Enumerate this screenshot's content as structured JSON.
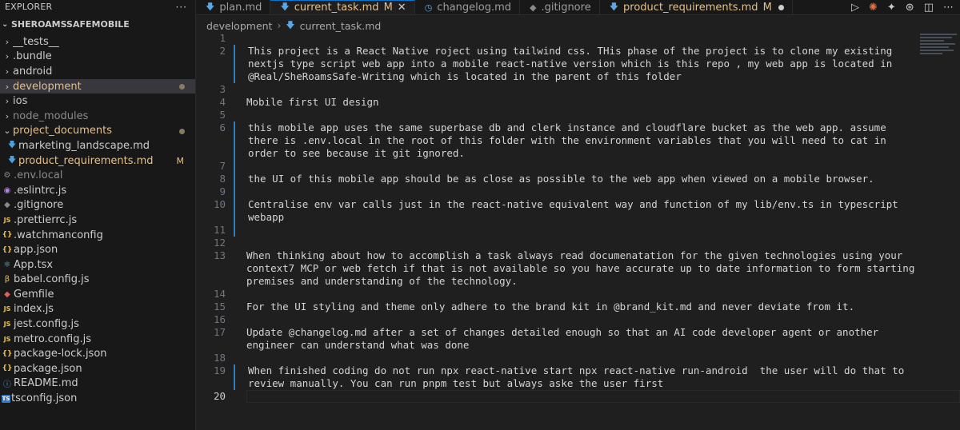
{
  "explorer": {
    "title": "EXPLORER",
    "more": "···",
    "project": "SHEROAMSSAFEMOBILE",
    "items": [
      {
        "label": "__tests__",
        "type": "folder",
        "chev": "›",
        "icon": "",
        "iconClass": "",
        "labelClass": "",
        "selected": false,
        "dot": false,
        "badge": ""
      },
      {
        "label": ".bundle",
        "type": "folder",
        "chev": "›",
        "icon": "",
        "iconClass": "",
        "labelClass": "",
        "selected": false,
        "dot": false,
        "badge": ""
      },
      {
        "label": "android",
        "type": "folder",
        "chev": "›",
        "icon": "",
        "iconClass": "",
        "labelClass": "",
        "selected": false,
        "dot": false,
        "badge": ""
      },
      {
        "label": "development",
        "type": "folder",
        "chev": "›",
        "icon": "",
        "iconClass": "",
        "labelClass": "orange",
        "selected": true,
        "dot": true,
        "badge": ""
      },
      {
        "label": "ios",
        "type": "folder",
        "chev": "›",
        "icon": "",
        "iconClass": "",
        "labelClass": "",
        "selected": false,
        "dot": false,
        "badge": ""
      },
      {
        "label": "node_modules",
        "type": "folder",
        "chev": "›",
        "icon": "",
        "iconClass": "",
        "labelClass": "dim",
        "selected": false,
        "dot": false,
        "badge": ""
      },
      {
        "label": "project_documents",
        "type": "folder",
        "chev": "⌄",
        "icon": "",
        "iconClass": "",
        "labelClass": "orange",
        "selected": false,
        "dot": true,
        "badge": ""
      },
      {
        "label": "marketing_landscape.md",
        "type": "file",
        "chev": "",
        "icon": "🡇",
        "iconClass": "i-blue",
        "labelClass": "",
        "selected": false,
        "dot": false,
        "badge": "",
        "indent": true
      },
      {
        "label": "product_requirements.md",
        "type": "file",
        "chev": "",
        "icon": "🡇",
        "iconClass": "i-blue",
        "labelClass": "orange",
        "selected": false,
        "dot": false,
        "badge": "M",
        "indent": true
      },
      {
        "label": ".env.local",
        "type": "file",
        "chev": "",
        "icon": "⚙",
        "iconClass": "i-gray",
        "labelClass": "dim",
        "selected": false,
        "dot": false,
        "badge": ""
      },
      {
        "label": ".eslintrc.js",
        "type": "file",
        "chev": "",
        "icon": "◉",
        "iconClass": "i-purple",
        "labelClass": "",
        "selected": false,
        "dot": false,
        "badge": ""
      },
      {
        "label": ".gitignore",
        "type": "file",
        "chev": "",
        "icon": "◆",
        "iconClass": "i-gray",
        "labelClass": "",
        "selected": false,
        "dot": false,
        "badge": ""
      },
      {
        "label": ".prettierrc.js",
        "type": "file",
        "chev": "",
        "icon": "JS",
        "iconClass": "i-js",
        "labelClass": "",
        "selected": false,
        "dot": false,
        "badge": ""
      },
      {
        "label": ".watchmanconfig",
        "type": "file",
        "chev": "",
        "icon": "{}",
        "iconClass": "i-json",
        "labelClass": "",
        "selected": false,
        "dot": false,
        "badge": ""
      },
      {
        "label": "app.json",
        "type": "file",
        "chev": "",
        "icon": "{}",
        "iconClass": "i-json",
        "labelClass": "",
        "selected": false,
        "dot": false,
        "badge": ""
      },
      {
        "label": "App.tsx",
        "type": "file",
        "chev": "",
        "icon": "⚛",
        "iconClass": "i-teal",
        "labelClass": "",
        "selected": false,
        "dot": false,
        "badge": ""
      },
      {
        "label": "babel.config.js",
        "type": "file",
        "chev": "",
        "icon": "β",
        "iconClass": "i-yellow",
        "labelClass": "",
        "selected": false,
        "dot": false,
        "badge": ""
      },
      {
        "label": "Gemfile",
        "type": "file",
        "chev": "",
        "icon": "◆",
        "iconClass": "i-red",
        "labelClass": "",
        "selected": false,
        "dot": false,
        "badge": ""
      },
      {
        "label": "index.js",
        "type": "file",
        "chev": "",
        "icon": "JS",
        "iconClass": "i-js",
        "labelClass": "",
        "selected": false,
        "dot": false,
        "badge": ""
      },
      {
        "label": "jest.config.js",
        "type": "file",
        "chev": "",
        "icon": "JS",
        "iconClass": "i-js",
        "labelClass": "",
        "selected": false,
        "dot": false,
        "badge": ""
      },
      {
        "label": "metro.config.js",
        "type": "file",
        "chev": "",
        "icon": "JS",
        "iconClass": "i-js",
        "labelClass": "",
        "selected": false,
        "dot": false,
        "badge": ""
      },
      {
        "label": "package-lock.json",
        "type": "file",
        "chev": "",
        "icon": "{}",
        "iconClass": "i-json",
        "labelClass": "",
        "selected": false,
        "dot": false,
        "badge": ""
      },
      {
        "label": "package.json",
        "type": "file",
        "chev": "",
        "icon": "{}",
        "iconClass": "i-json",
        "labelClass": "",
        "selected": false,
        "dot": false,
        "badge": ""
      },
      {
        "label": "README.md",
        "type": "file",
        "chev": "",
        "icon": "ⓘ",
        "iconClass": "i-blue",
        "labelClass": "",
        "selected": false,
        "dot": false,
        "badge": ""
      },
      {
        "label": "tsconfig.json",
        "type": "file",
        "chev": "",
        "icon": "TS",
        "iconClass": "i-ts",
        "labelClass": "",
        "selected": false,
        "dot": false,
        "badge": ""
      }
    ]
  },
  "tabs": [
    {
      "label": "plan.md",
      "icon": "🡇",
      "iconClass": "tab-blue",
      "active": false,
      "modified": "",
      "close": false,
      "dot": false
    },
    {
      "label": "current_task.md",
      "icon": "🡇",
      "iconClass": "tab-blue",
      "active": true,
      "modified": "M",
      "close": true,
      "dot": false
    },
    {
      "label": "changelog.md",
      "icon": "◷",
      "iconClass": "tab-blue",
      "active": false,
      "modified": "",
      "close": false,
      "dot": false
    },
    {
      "label": ".gitignore",
      "icon": "◆",
      "iconClass": "tab-gray",
      "active": false,
      "modified": "",
      "close": false,
      "dot": false
    },
    {
      "label": "product_requirements.md",
      "icon": "🡇",
      "iconClass": "tab-blue",
      "active": false,
      "modified": "M",
      "close": false,
      "dot": true
    }
  ],
  "tab_close_glyph": "✕",
  "actions": {
    "run": "▷",
    "spark": "✺",
    "star": "✦",
    "openai": "⊛",
    "split": "◫",
    "more": "⋯"
  },
  "breadcrumb": {
    "folder": "development",
    "separator": "›",
    "file": "current_task.md"
  },
  "editor": {
    "current_line": 20,
    "lines": [
      {
        "n": 1,
        "text": "",
        "mod": false
      },
      {
        "n": 2,
        "text": "This project is a React Native roject using tailwind css. THis phase of the project is to clone my existing nextjs type script web app into a mobile react-native version which is this repo , my web app is located in @Real/SheRoamsSafe-Writing which is located in the parent of this folder",
        "mod": true
      },
      {
        "n": 3,
        "text": "",
        "mod": false
      },
      {
        "n": 4,
        "text": "Mobile first UI design",
        "mod": false
      },
      {
        "n": 5,
        "text": "",
        "mod": false
      },
      {
        "n": 6,
        "text": "this mobile app uses the same superbase db and clerk instance and cloudflare bucket as the web app. assume there is .env.local in the root of this folder with the environment variables that you will need to cat in order to see because it git ignored.",
        "mod": true
      },
      {
        "n": 7,
        "text": "",
        "mod": true
      },
      {
        "n": 8,
        "text": "the UI of this mobile app should be as close as possible to the web app when viewed on a mobile browser.",
        "mod": true
      },
      {
        "n": 9,
        "text": "",
        "mod": true
      },
      {
        "n": 10,
        "text": "Centralise env var calls just in the react-native equivalent way and function of my lib/env.ts in typescript webapp",
        "mod": true
      },
      {
        "n": 11,
        "text": "",
        "mod": true
      },
      {
        "n": 12,
        "text": "",
        "mod": false
      },
      {
        "n": 13,
        "text": "When thinking about how to accomplish a task always read documenatation for the given technologies using your context7 MCP or web fetch if that is not available so you have accurate up to date information to form starting premises and understanding of the technology.",
        "mod": false
      },
      {
        "n": 14,
        "text": "",
        "mod": false
      },
      {
        "n": 15,
        "text": "For the UI styling and theme only adhere to the brand kit in @brand_kit.md and never deviate from it.",
        "mod": false
      },
      {
        "n": 16,
        "text": "",
        "mod": false
      },
      {
        "n": 17,
        "text": "Update @changelog.md after a set of changes detailed enough so that an AI code developer agent or another engineer can understand what was done",
        "mod": false
      },
      {
        "n": 18,
        "text": "",
        "mod": false
      },
      {
        "n": 19,
        "text": "When finished coding do not run npx react-native start npx react-native run-android  the user will do that to review manually. You can run pnpm test but always aske the user first",
        "mod": true
      },
      {
        "n": 20,
        "text": "",
        "mod": false
      }
    ]
  }
}
